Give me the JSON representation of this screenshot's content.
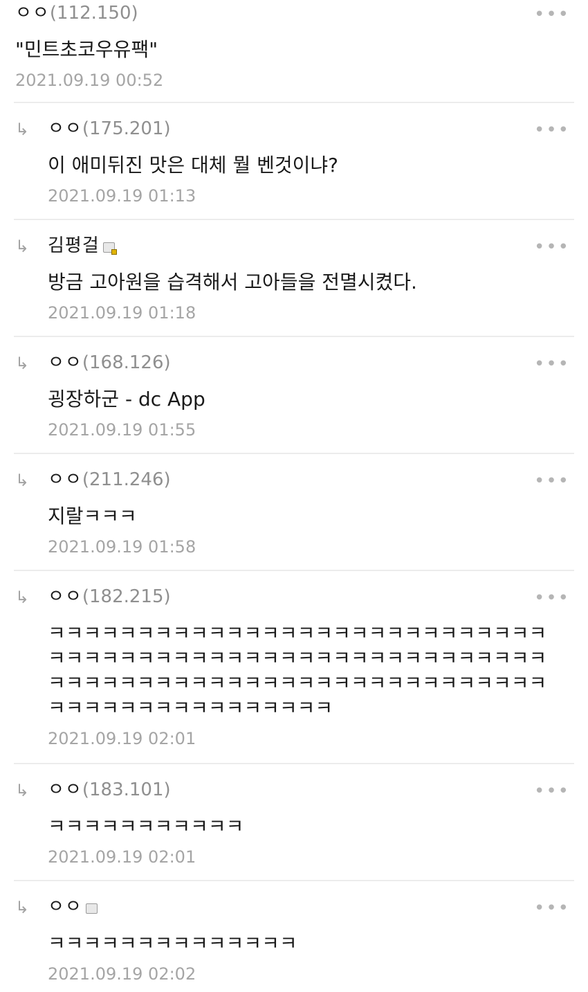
{
  "more_symbol": "•••",
  "reply_arrow": "↳",
  "comments": [
    {
      "nick": "ㅇㅇ",
      "ip": "(112.150)",
      "text": "\"민트초코우유팩\"",
      "date": "2021.09.19 00:52"
    },
    {
      "nick": "ㅇㅇ",
      "ip": "(175.201)",
      "text": "이 애미뒤진 맛은 대체 뭘 벤것이냐?",
      "date": "2021.09.19 01:13"
    },
    {
      "nick": "김평걸",
      "ip": "",
      "text": "방금 고아원을 습격해서 고아들을 전멸시켰다.",
      "date": "2021.09.19 01:18"
    },
    {
      "nick": "ㅇㅇ",
      "ip": "(168.126)",
      "text": "굉장하군 - dc App",
      "date": "2021.09.19 01:55"
    },
    {
      "nick": "ㅇㅇ",
      "ip": "(211.246)",
      "text": "지랄ㅋㅋㅋ",
      "date": "2021.09.19 01:58"
    },
    {
      "nick": "ㅇㅇ",
      "ip": "(182.215)",
      "text": "ㅋㅋㅋㅋㅋㅋㅋㅋㅋㅋㅋㅋㅋㅋㅋㅋㅋㅋㅋㅋㅋㅋㅋㅋㅋㅋㅋㅋㅋㅋㅋㅋㅋㅋㅋㅋㅋㅋㅋㅋㅋㅋㅋㅋㅋㅋㅋㅋㅋㅋㅋㅋㅋㅋㅋㅋㅋㅋㅋㅋㅋㅋㅋㅋㅋㅋㅋㅋㅋㅋㅋㅋㅋㅋㅋㅋㅋㅋㅋㅋㅋㅋㅋㅋㅋㅋㅋㅋㅋㅋㅋㅋㅋㅋㅋㅋㅋㅋㅋㅋ",
      "date": "2021.09.19 02:01"
    },
    {
      "nick": "ㅇㅇ",
      "ip": "(183.101)",
      "text": "ㅋㅋㅋㅋㅋㅋㅋㅋㅋㅋㅋ",
      "date": "2021.09.19 02:01"
    },
    {
      "nick": "ㅇㅇ",
      "ip": "",
      "text": "ㅋㅋㅋㅋㅋㅋㅋㅋㅋㅋㅋㅋㅋㅋ",
      "date": "2021.09.19 02:02"
    }
  ]
}
